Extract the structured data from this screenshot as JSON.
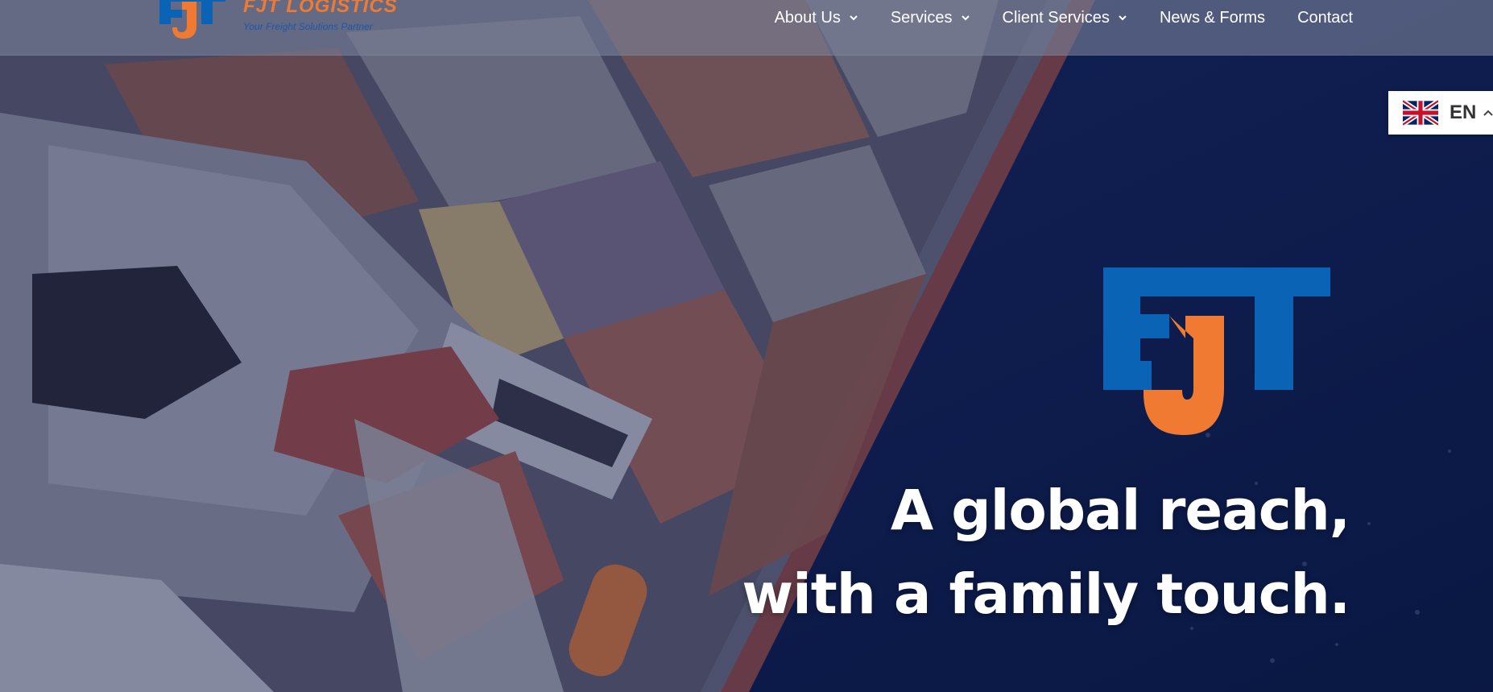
{
  "brand": {
    "name": "FJT LOGISTICS",
    "tagline": "Your Freight Solutions Partner",
    "colors": {
      "blue": "#0b63b6",
      "orange": "#f07a32"
    }
  },
  "nav": {
    "items": [
      {
        "label": "About Us",
        "has_dropdown": true
      },
      {
        "label": "Services",
        "has_dropdown": true
      },
      {
        "label": "Client Services",
        "has_dropdown": true
      },
      {
        "label": "News & Forms",
        "has_dropdown": false
      },
      {
        "label": "Contact",
        "has_dropdown": false
      }
    ]
  },
  "language": {
    "code": "EN",
    "flag": "uk-flag-icon"
  },
  "hero": {
    "headline_line1": "A global reach,",
    "headline_line2": "with a family touch."
  }
}
